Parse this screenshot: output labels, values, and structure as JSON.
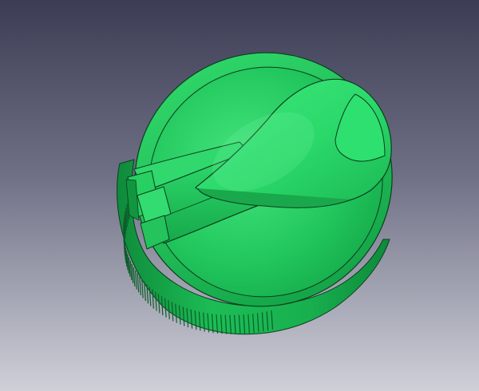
{
  "viewport": {
    "background_top": "#3c3d54",
    "background_bottom": "#cfd0d8"
  },
  "model": {
    "name": "bottle-cap-with-flip-lid",
    "body_color": "#1ec45a",
    "highlight_color": "#5cf294",
    "shadow_color": "#0b7a34",
    "edge_color": "#0d3d1d"
  }
}
